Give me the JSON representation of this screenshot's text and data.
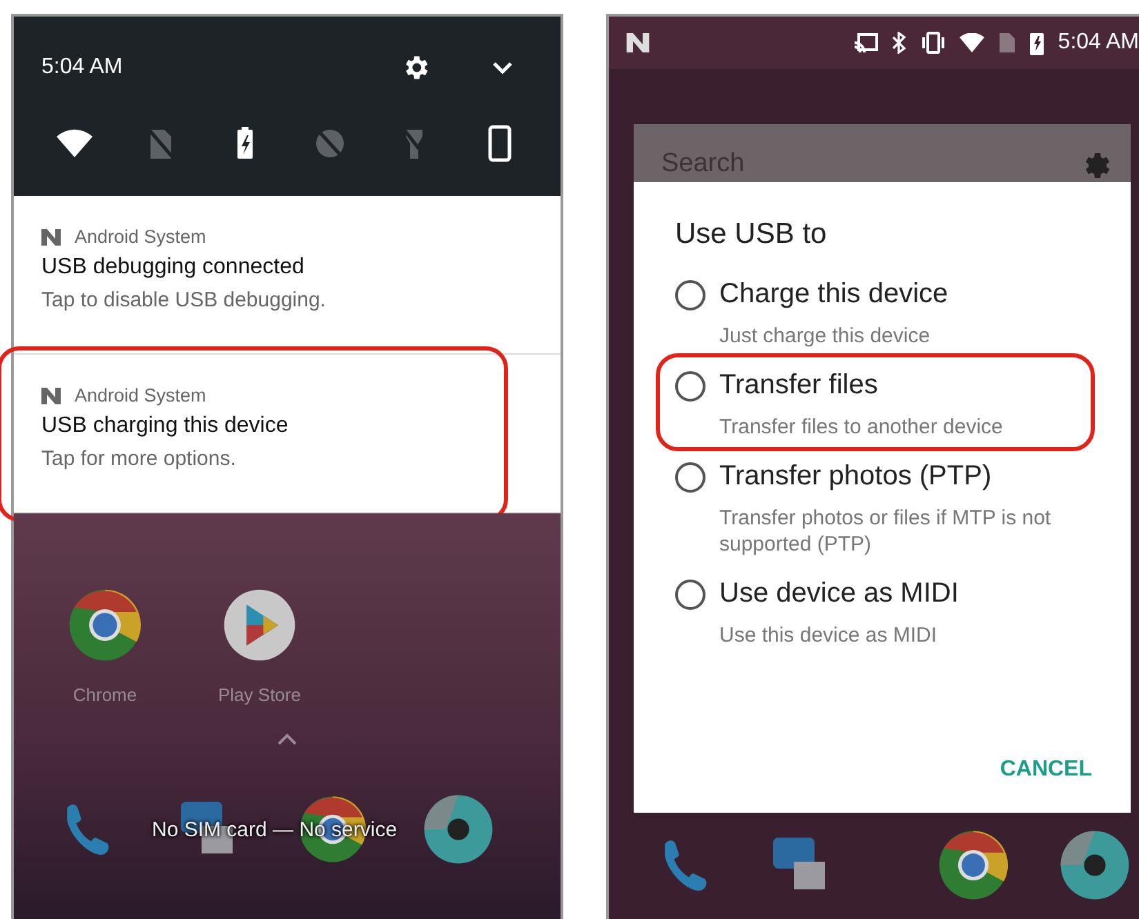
{
  "left_screen": {
    "time": "5:04 AM",
    "quick_settings": [
      {
        "kind": "wifi",
        "on": true
      },
      {
        "kind": "sim",
        "on": false
      },
      {
        "kind": "battery",
        "on": true
      },
      {
        "kind": "data",
        "on": false
      },
      {
        "kind": "flashlight",
        "on": false
      },
      {
        "kind": "rotation",
        "on": true
      }
    ],
    "notifications": [
      {
        "app": "Android System",
        "title": "USB debugging connected",
        "text": "Tap to disable USB debugging.",
        "highlighted": false
      },
      {
        "app": "Android System",
        "title": "USB charging this device",
        "text": "Tap for more options.",
        "highlighted": true
      }
    ],
    "home_apps": [
      {
        "kind": "chrome",
        "label": "Chrome"
      },
      {
        "kind": "store",
        "label": "Play Store"
      }
    ],
    "status_message": "No SIM card — No service"
  },
  "right_screen": {
    "time": "5:04 AM",
    "search": {
      "placeholder": "Search"
    },
    "dialog": {
      "title": "Use USB to",
      "options": [
        {
          "label": "Charge this device",
          "description": "Just charge this device",
          "selected": false,
          "highlighted": false
        },
        {
          "label": "Transfer files",
          "description": "Transfer files to another device",
          "selected": false,
          "highlighted": true
        },
        {
          "label": "Transfer photos (PTP)",
          "description": "Transfer photos or files if MTP is not supported (PTP)",
          "selected": false,
          "highlighted": false
        },
        {
          "label": "Use device as MIDI",
          "description": "Use this device as MIDI",
          "selected": false,
          "highlighted": false
        }
      ],
      "cancel": "CANCEL"
    }
  }
}
